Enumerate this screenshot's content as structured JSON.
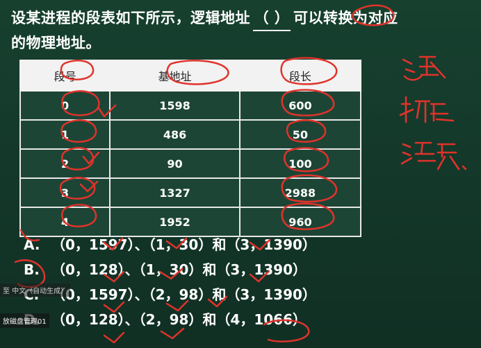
{
  "question": {
    "line1_a": "设某进程的段表如下所示，逻辑地址",
    "blank": "（ ）",
    "line1_b": "可以转换为对应",
    "line2": "的物理地址。"
  },
  "table": {
    "headers": [
      "段号",
      "基地址",
      "段长"
    ],
    "rows": [
      [
        "0",
        "1598",
        "600"
      ],
      [
        "1",
        "486",
        "50"
      ],
      [
        "2",
        "90",
        "100"
      ],
      [
        "3",
        "1327",
        "2988"
      ],
      [
        "4",
        "1952",
        "960"
      ]
    ]
  },
  "options": [
    {
      "letter": "A.",
      "text": "（0，1597）、（1，30）和（3，1390）"
    },
    {
      "letter": "B.",
      "text": "（0，128）、（1，30）和（3，1390）"
    },
    {
      "letter": "C.",
      "text": "（0，1597）、（2，98）和（3，1390）"
    },
    {
      "letter": "D.",
      "text": "（0，128）、（2，98）和（4，1066）"
    }
  ],
  "overlays": {
    "caption": "至 中文（自动生成）",
    "video_title": "放磁盘管理01"
  },
  "handwriting": [
    "逻辑",
    "物理",
    "溢界"
  ],
  "colors": {
    "board": "#14382b",
    "ink": "#e0332b"
  }
}
